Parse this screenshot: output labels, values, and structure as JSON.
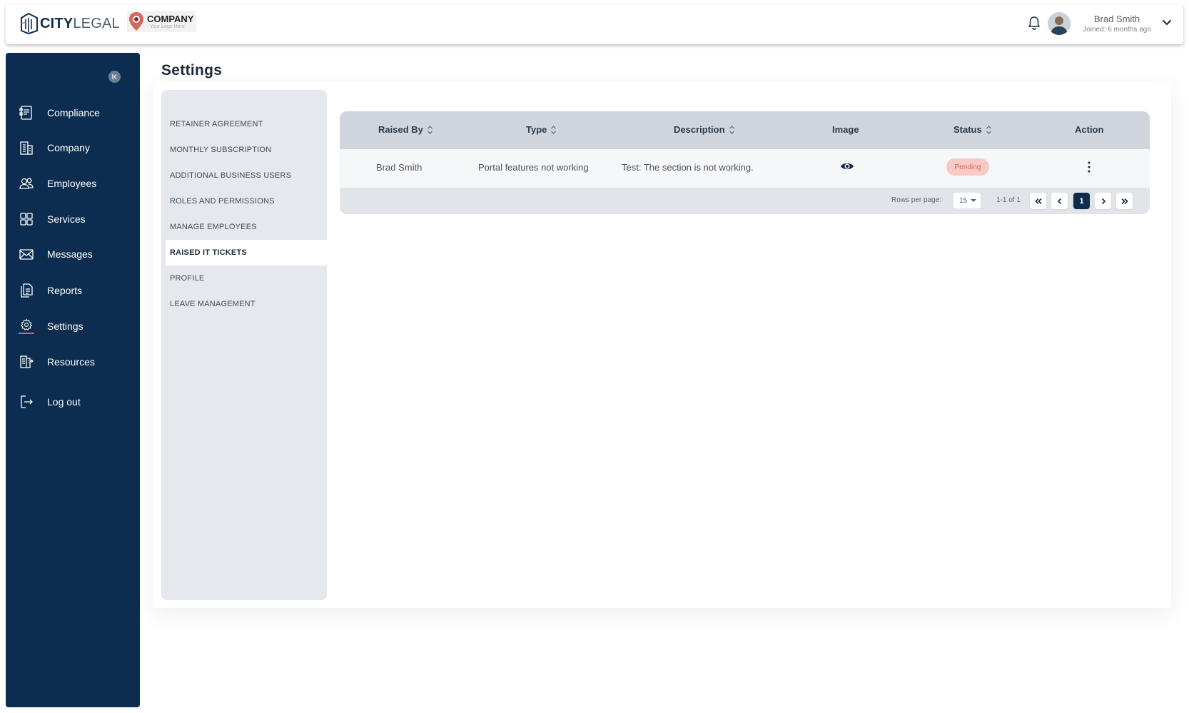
{
  "header": {
    "brand_bold": "CITY",
    "brand_light": "LEGAL",
    "company_name": "COMPANY",
    "company_tagline": "Your Logo Here",
    "user_name": "Brad Smith",
    "user_joined": "Joined: 6 months ago"
  },
  "sidebar": {
    "items": [
      {
        "label": "Compliance",
        "icon": "compliance-icon"
      },
      {
        "label": "Company",
        "icon": "building-icon"
      },
      {
        "label": "Employees",
        "icon": "users-icon"
      },
      {
        "label": "Services",
        "icon": "grid-icon"
      },
      {
        "label": "Messages",
        "icon": "envelope-icon"
      },
      {
        "label": "Reports",
        "icon": "documents-icon"
      },
      {
        "label": "Settings",
        "icon": "gear-icon"
      },
      {
        "label": "Resources",
        "icon": "resources-icon"
      },
      {
        "label": "Log out",
        "icon": "logout-icon"
      }
    ],
    "active": "Settings"
  },
  "page": {
    "title": "Settings"
  },
  "settings_nav": {
    "items": [
      "RETAINER AGREEMENT",
      "MONTHLY SUBSCRIPTION",
      "ADDITIONAL BUSINESS USERS",
      "ROLES AND PERMISSIONS",
      "MANAGE EMPLOYEES",
      "RAISED IT TICKETS",
      "PROFILE",
      "LEAVE MANAGEMENT"
    ],
    "active": "RAISED IT TICKETS"
  },
  "table": {
    "columns": [
      "Raised By",
      "Type",
      "Description",
      "Image",
      "Status",
      "Action"
    ],
    "rows": [
      {
        "raised_by": "Brad Smith",
        "type": "Portal features not working",
        "description": "Test: The section is not working.",
        "status": "Pending"
      }
    ]
  },
  "pagination": {
    "rows_per_page_label": "Rows per page:",
    "rows_per_page": "15",
    "range": "1-1 of 1",
    "current_page": "1"
  },
  "colors": {
    "sidebar_bg": "#0c2d4f",
    "status_pending_bg": "#f8c9c5",
    "status_pending_text": "#d66a5e",
    "accent": "#d4695a"
  }
}
